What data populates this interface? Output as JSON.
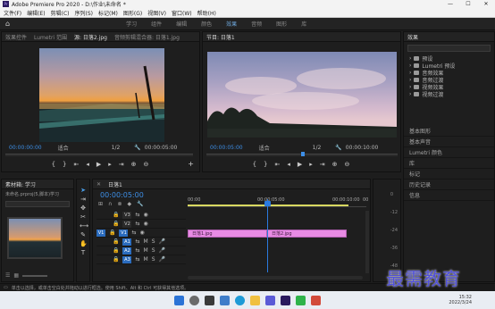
{
  "window": {
    "title": "Adobe Premiere Pro 2020 - D:\\作业\\未命名 *"
  },
  "menu": [
    "文件(F)",
    "编辑(E)",
    "剪辑(C)",
    "序列(S)",
    "标记(M)",
    "图形(G)",
    "视图(V)",
    "窗口(W)",
    "帮助(H)"
  ],
  "workspaces": [
    "学习",
    "组件",
    "编辑",
    "颜色",
    "效果",
    "音频",
    "图形",
    "库"
  ],
  "active_workspace": "效果",
  "source_panel": {
    "tabs": [
      "效果控件",
      "Lumetri 范围",
      "源: 日落2.jpg",
      "音频剪辑混合器: 日落1.jpg"
    ],
    "timecode": "00:00:00:00",
    "fit": "适合",
    "ratio": "1/2",
    "duration": "00:00:05:00"
  },
  "program_panel": {
    "title": "节目: 日落1",
    "timecode": "00:00:05:00",
    "fit": "适合",
    "ratio": "1/2",
    "duration": "00:00:10:00"
  },
  "effects_panel": {
    "title": "效果",
    "tree": [
      "预设",
      "Lumetri 预设",
      "音频效果",
      "音频过渡",
      "视频效果",
      "视频过渡"
    ],
    "sections": [
      "基本图形",
      "基本声音",
      "Lumetri 颜色",
      "库",
      "标记",
      "历史记录",
      "信息"
    ]
  },
  "project_panel": {
    "title": "素材箱: 学习",
    "filename": "未命名.prproj(5,脚本)学习"
  },
  "timeline": {
    "tab": "日落1",
    "timecode": "00:00:05:00",
    "ruler": [
      "00:00",
      "00:00:05:00",
      "00:00:10:00",
      "00"
    ],
    "video_tracks": [
      "V3",
      "V2",
      "V1"
    ],
    "audio_tracks": [
      "A1",
      "A2",
      "A3"
    ],
    "clips": [
      {
        "name": "日落1.jpg"
      },
      {
        "name": "日落2.jpg"
      }
    ]
  },
  "audio_meter": {
    "labels": [
      "0",
      "-12",
      "-24",
      "-36",
      "-48"
    ]
  },
  "status": {
    "text": "单击以选择，或单击空白处并拖动以进行框选。使用 Shift、Alt 和 Ctrl 可获得其他选项。"
  },
  "taskbar": {
    "time": "15:32",
    "date": "2022/3/24"
  },
  "watermark": "最需教育",
  "colors": {
    "accent": "#3d8ee6",
    "clip": "#e88be4",
    "playhead": "#2b7be0"
  }
}
